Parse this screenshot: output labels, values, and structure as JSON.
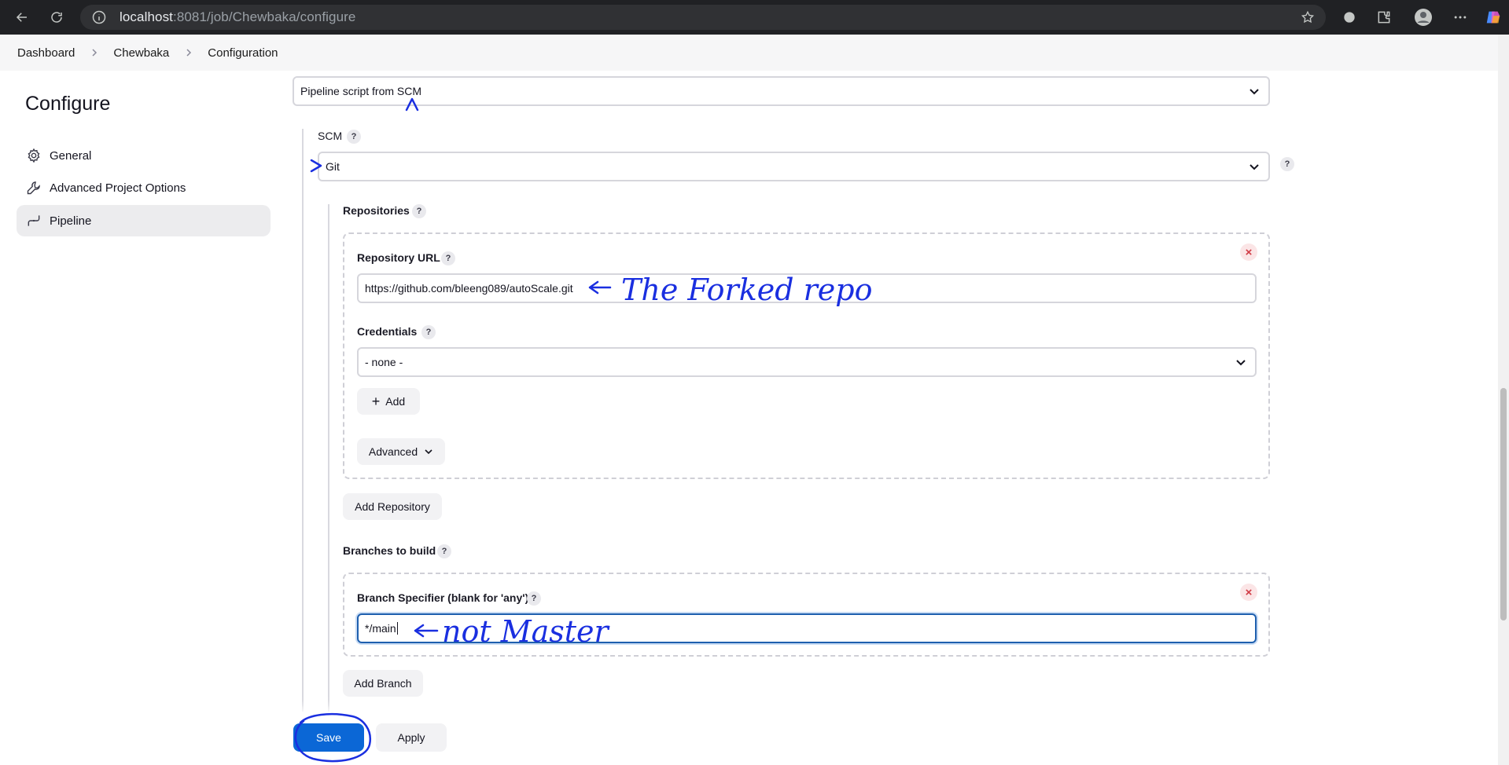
{
  "browser": {
    "url_host": "localhost",
    "url_path": ":8081/job/Chewbaka/configure"
  },
  "breadcrumb": [
    "Dashboard",
    "Chewbaka",
    "Configuration"
  ],
  "sidebar": {
    "title": "Configure",
    "items": [
      {
        "label": "General",
        "icon": "gear-icon",
        "active": false
      },
      {
        "label": "Advanced Project Options",
        "icon": "wrench-icon",
        "active": false
      },
      {
        "label": "Pipeline",
        "icon": "pipeline-icon",
        "active": true
      }
    ]
  },
  "pipeline": {
    "definition_value": "Pipeline script from SCM",
    "scm_label": "SCM",
    "scm_value": "Git",
    "repositories_label": "Repositories",
    "repo_url_label": "Repository URL",
    "repo_url_value": "https://github.com/bleeng089/autoScale.git",
    "credentials_label": "Credentials",
    "credentials_value": "- none -",
    "add_label": "Add",
    "advanced_label": "Advanced",
    "add_repository_label": "Add Repository",
    "branches_label": "Branches to build",
    "branch_specifier_label": "Branch Specifier (blank for 'any')",
    "branch_specifier_value": "*/main",
    "add_branch_label": "Add Branch"
  },
  "actions": {
    "save_label": "Save",
    "apply_label": "Apply"
  },
  "annotations": {
    "forked_note": "The Forked repo",
    "branch_note": "not Master"
  },
  "colors": {
    "primary": "#0b67d6",
    "annotation_ink": "#1a2fe0",
    "danger": "#d03a44"
  }
}
